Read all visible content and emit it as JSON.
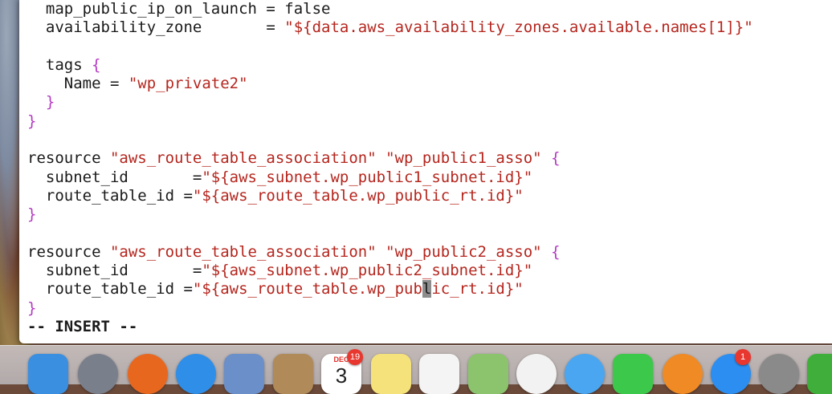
{
  "editor": {
    "mode_indicator": "-- INSERT --",
    "lines": [
      [
        {
          "t": "  map_public_ip_on_launch = false",
          "c": ""
        }
      ],
      [
        {
          "t": "  availability_zone       = ",
          "c": ""
        },
        {
          "t": "\"${data.aws_availability_zones.available.names[1]}\"",
          "c": "str"
        }
      ],
      [
        {
          "t": "",
          "c": ""
        }
      ],
      [
        {
          "t": "  tags ",
          "c": ""
        },
        {
          "t": "{",
          "c": "brace"
        }
      ],
      [
        {
          "t": "    Name = ",
          "c": ""
        },
        {
          "t": "\"wp_private2\"",
          "c": "str"
        }
      ],
      [
        {
          "t": "  ",
          "c": ""
        },
        {
          "t": "}",
          "c": "brace"
        }
      ],
      [
        {
          "t": "}",
          "c": "brace"
        }
      ],
      [
        {
          "t": "",
          "c": ""
        }
      ],
      [
        {
          "t": "resource ",
          "c": ""
        },
        {
          "t": "\"aws_route_table_association\"",
          "c": "str"
        },
        {
          "t": " ",
          "c": ""
        },
        {
          "t": "\"wp_public1_asso\"",
          "c": "str"
        },
        {
          "t": " ",
          "c": ""
        },
        {
          "t": "{",
          "c": "brace"
        }
      ],
      [
        {
          "t": "  subnet_id       =",
          "c": ""
        },
        {
          "t": "\"${aws_subnet.wp_public1_subnet.id}\"",
          "c": "str"
        }
      ],
      [
        {
          "t": "  route_table_id =",
          "c": ""
        },
        {
          "t": "\"${aws_route_table.wp_public_rt.id}\"",
          "c": "str"
        }
      ],
      [
        {
          "t": "}",
          "c": "brace"
        }
      ],
      [
        {
          "t": "",
          "c": ""
        }
      ],
      [
        {
          "t": "resource ",
          "c": ""
        },
        {
          "t": "\"aws_route_table_association\"",
          "c": "str"
        },
        {
          "t": " ",
          "c": ""
        },
        {
          "t": "\"wp_public2_asso\"",
          "c": "str"
        },
        {
          "t": " ",
          "c": ""
        },
        {
          "t": "{",
          "c": "brace"
        }
      ],
      [
        {
          "t": "  subnet_id       =",
          "c": ""
        },
        {
          "t": "\"${aws_subnet.wp_public2_subnet.id}\"",
          "c": "str"
        }
      ],
      [
        {
          "t": "  route_table_id =",
          "c": ""
        },
        {
          "t": "\"${aws_route_table.wp_pub",
          "c": "str"
        },
        {
          "t": "l",
          "c": "str cursor"
        },
        {
          "t": "ic_rt.id}\"",
          "c": "str"
        }
      ],
      [
        {
          "t": "}",
          "c": "brace"
        }
      ]
    ]
  },
  "dock": {
    "calendar_month": "DEC",
    "calendar_day": "3",
    "calendar_badge": "19",
    "appstore_badge": "1",
    "icons": [
      {
        "name": "finder-icon",
        "color": "#3b8fe0"
      },
      {
        "name": "launchpad-icon",
        "color": "#7a7f8c"
      },
      {
        "name": "firefox-icon",
        "color": "#e8671f"
      },
      {
        "name": "safari-icon",
        "color": "#2f8ee8"
      },
      {
        "name": "mail-icon",
        "color": "#6a8fc9"
      },
      {
        "name": "contacts-icon",
        "color": "#b08a58"
      },
      {
        "name": "calendar-icon",
        "color": "#ffffff"
      },
      {
        "name": "notes-icon",
        "color": "#f6e27a"
      },
      {
        "name": "reminders-icon",
        "color": "#f4f4f4"
      },
      {
        "name": "maps-icon",
        "color": "#8cc46e"
      },
      {
        "name": "photos-icon",
        "color": "#f2f2f2"
      },
      {
        "name": "messages-icon",
        "color": "#4aa6f0"
      },
      {
        "name": "facetime-icon",
        "color": "#3cc84a"
      },
      {
        "name": "ibooks-icon",
        "color": "#f08a24"
      },
      {
        "name": "app-store-icon",
        "color": "#2b8ef0"
      },
      {
        "name": "system-preferences-icon",
        "color": "#8a8a8a"
      },
      {
        "name": "frog-app-icon",
        "color": "#3fae3a"
      }
    ]
  }
}
